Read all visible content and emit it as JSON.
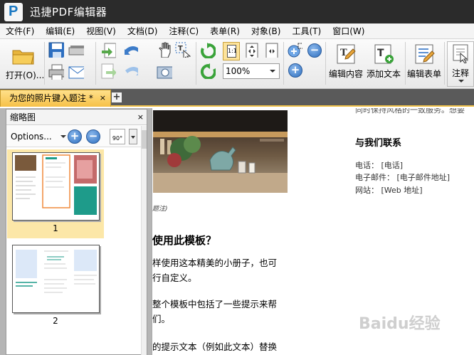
{
  "window": {
    "title": "迅捷PDF编辑器"
  },
  "menu": [
    "文件(F)",
    "编辑(E)",
    "视图(V)",
    "文档(D)",
    "注释(C)",
    "表单(R)",
    "对象(B)",
    "工具(T)",
    "窗口(W)"
  ],
  "toolbar": {
    "open_label": "打开(O)...",
    "zoom_value": "100%",
    "edit_content_label": "编辑内容",
    "add_text_label": "添加文本",
    "edit_form_label": "编辑表单",
    "annotate_label": "注释"
  },
  "tab": {
    "title": "为您的照片键入题注 *",
    "close": "×",
    "new": "+"
  },
  "thumbnails": {
    "title": "缩略图",
    "close": "×",
    "options_label": "Options...",
    "rotate_label": "90°",
    "pages": [
      {
        "number": "1",
        "selected": true
      },
      {
        "number": "2",
        "selected": false
      }
    ]
  },
  "document": {
    "top_cut": "同时保持风格的一致服务。想要",
    "caption": "题注)",
    "heading": "使用此模板？",
    "paragraphs": [
      "样使用这本精美的小册子，也可",
      "行自定义。",
      "整个模板中包括了一些提示来帮",
      "们。",
      "的提示文本（例如此文本）替换"
    ],
    "contact": {
      "title": "与我们联系",
      "phone": "电话：  [电话]",
      "email": "电子邮件：  [电子邮件地址]",
      "website": "网站：  [Web 地址]"
    }
  },
  "watermark": "Baidu经验"
}
